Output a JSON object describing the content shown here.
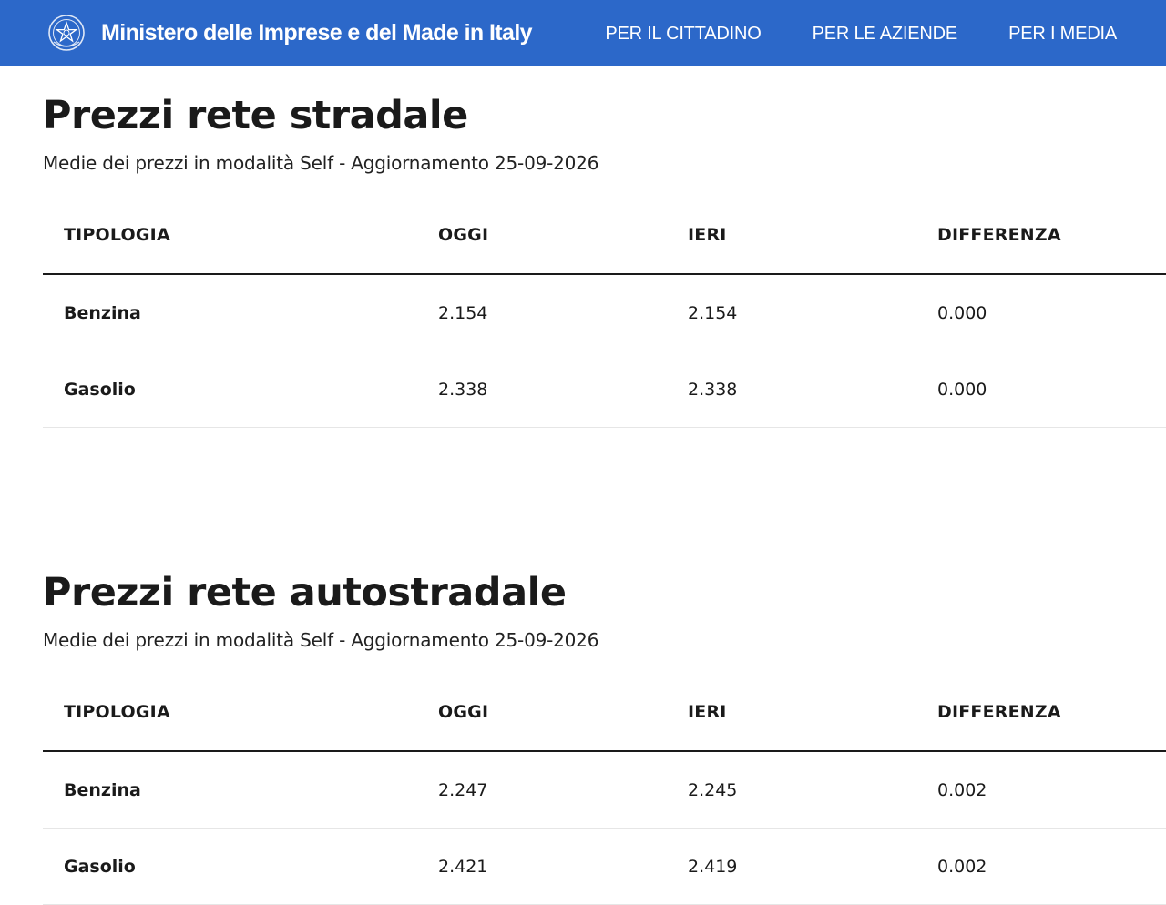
{
  "header": {
    "site_title": "Ministero delle Imprese e del Made in Italy",
    "emblem_icon": "italian-republic-emblem-icon",
    "background_color": "#2c68c9",
    "nav": [
      {
        "label": "PER IL CITTADINO"
      },
      {
        "label": "PER LE AZIENDE"
      },
      {
        "label": "PER I MEDIA"
      }
    ]
  },
  "sections": [
    {
      "title": "Prezzi rete stradale",
      "subtitle": "Medie dei prezzi in modalità Self - Aggiornamento 25-09-2026",
      "columns": [
        "TIPOLOGIA",
        "OGGI",
        "IERI",
        "DIFFERENZA"
      ],
      "rows": [
        {
          "type": "Benzina",
          "today": "2.154",
          "yesterday": "2.154",
          "diff": "0.000"
        },
        {
          "type": "Gasolio",
          "today": "2.338",
          "yesterday": "2.338",
          "diff": "0.000"
        }
      ]
    },
    {
      "title": "Prezzi rete autostradale",
      "subtitle": "Medie dei prezzi in modalità Self - Aggiornamento 25-09-2026",
      "columns": [
        "TIPOLOGIA",
        "OGGI",
        "IERI",
        "DIFFERENZA"
      ],
      "rows": [
        {
          "type": "Benzina",
          "today": "2.247",
          "yesterday": "2.245",
          "diff": "0.002"
        },
        {
          "type": "Gasolio",
          "today": "2.421",
          "yesterday": "2.419",
          "diff": "0.002"
        }
      ]
    }
  ]
}
